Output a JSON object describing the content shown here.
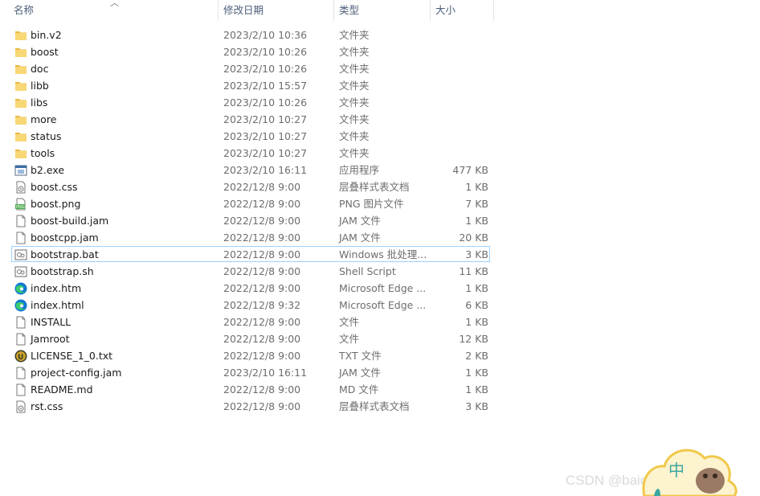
{
  "columns": {
    "name": "名称",
    "date": "修改日期",
    "type": "类型",
    "size": "大小"
  },
  "files": [
    {
      "name": "bin.v2",
      "date": "2023/2/10 10:36",
      "type": "文件夹",
      "size": "",
      "icon": "folder-icon"
    },
    {
      "name": "boost",
      "date": "2023/2/10 10:26",
      "type": "文件夹",
      "size": "",
      "icon": "folder-icon"
    },
    {
      "name": "doc",
      "date": "2023/2/10 10:26",
      "type": "文件夹",
      "size": "",
      "icon": "folder-icon"
    },
    {
      "name": "libb",
      "date": "2023/2/10 15:57",
      "type": "文件夹",
      "size": "",
      "icon": "folder-icon"
    },
    {
      "name": "libs",
      "date": "2023/2/10 10:26",
      "type": "文件夹",
      "size": "",
      "icon": "folder-icon"
    },
    {
      "name": "more",
      "date": "2023/2/10 10:27",
      "type": "文件夹",
      "size": "",
      "icon": "folder-icon"
    },
    {
      "name": "status",
      "date": "2023/2/10 10:27",
      "type": "文件夹",
      "size": "",
      "icon": "folder-icon"
    },
    {
      "name": "tools",
      "date": "2023/2/10 10:27",
      "type": "文件夹",
      "size": "",
      "icon": "folder-icon"
    },
    {
      "name": "b2.exe",
      "date": "2023/2/10 16:11",
      "type": "应用程序",
      "size": "477 KB",
      "icon": "exe-icon"
    },
    {
      "name": "boost.css",
      "date": "2022/12/8 9:00",
      "type": "层叠样式表文档",
      "size": "1 KB",
      "icon": "css-icon"
    },
    {
      "name": "boost.png",
      "date": "2022/12/8 9:00",
      "type": "PNG 图片文件",
      "size": "7 KB",
      "icon": "png-icon"
    },
    {
      "name": "boost-build.jam",
      "date": "2022/12/8 9:00",
      "type": "JAM 文件",
      "size": "1 KB",
      "icon": "file-icon"
    },
    {
      "name": "boostcpp.jam",
      "date": "2022/12/8 9:00",
      "type": "JAM 文件",
      "size": "20 KB",
      "icon": "file-icon"
    },
    {
      "name": "bootstrap.bat",
      "date": "2022/12/8 9:00",
      "type": "Windows 批处理...",
      "size": "3 KB",
      "icon": "script-icon",
      "focused": true
    },
    {
      "name": "bootstrap.sh",
      "date": "2022/12/8 9:00",
      "type": "Shell Script",
      "size": "11 KB",
      "icon": "script-icon"
    },
    {
      "name": "index.htm",
      "date": "2022/12/8 9:00",
      "type": "Microsoft Edge ...",
      "size": "1 KB",
      "icon": "edge-icon"
    },
    {
      "name": "index.html",
      "date": "2022/12/8 9:32",
      "type": "Microsoft Edge ...",
      "size": "6 KB",
      "icon": "edge-icon"
    },
    {
      "name": "INSTALL",
      "date": "2022/12/8 9:00",
      "type": "文件",
      "size": "1 KB",
      "icon": "file-icon"
    },
    {
      "name": "Jamroot",
      "date": "2022/12/8 9:00",
      "type": "文件",
      "size": "12 KB",
      "icon": "file-icon"
    },
    {
      "name": "LICENSE_1_0.txt",
      "date": "2022/12/8 9:00",
      "type": "TXT 文件",
      "size": "2 KB",
      "icon": "txt-icon"
    },
    {
      "name": "project-config.jam",
      "date": "2023/2/10 16:11",
      "type": "JAM 文件",
      "size": "1 KB",
      "icon": "file-icon"
    },
    {
      "name": "README.md",
      "date": "2022/12/8 9:00",
      "type": "MD 文件",
      "size": "1 KB",
      "icon": "file-icon"
    },
    {
      "name": "rst.css",
      "date": "2022/12/8 9:00",
      "type": "层叠样式表文档",
      "size": "3 KB",
      "icon": "css-icon"
    }
  ],
  "watermark": "CSDN @baidu_38951029",
  "mascot_char": "中",
  "colors": {
    "folder": "#f8d775",
    "folder_dark": "#e8b845",
    "edge_blue": "#0f78d4",
    "edge_green": "#3ccd6a",
    "focus_border": "#99d1ff",
    "header_text": "#4c607a"
  }
}
